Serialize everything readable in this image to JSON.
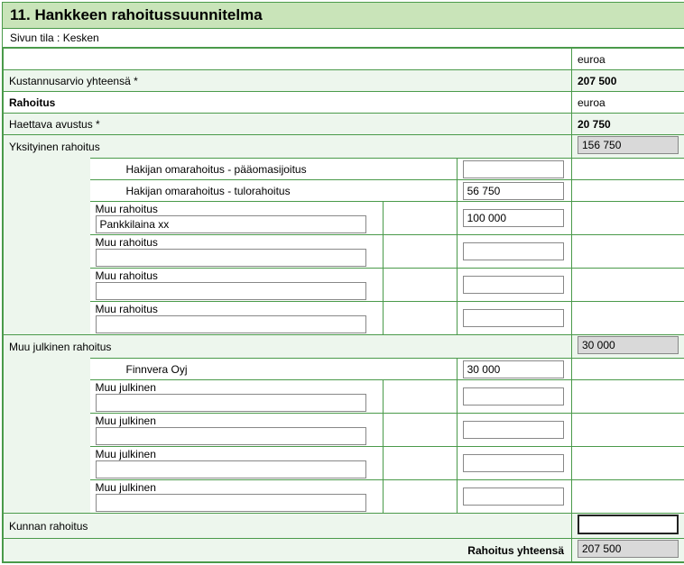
{
  "section": {
    "number": "11.",
    "title": "Hankkeen rahoitussuunnitelma"
  },
  "status": "Sivun tila : Kesken",
  "currency": "euroa",
  "rows": {
    "cost_label": "Kustannusarvio yhteensä *",
    "cost_value": "207 500",
    "financing_label": "Rahoitus",
    "financing_unit": "euroa",
    "grant_label": "Haettava avustus *",
    "grant_value": "20 750",
    "private_label": "Yksityinen rahoitus",
    "private_total": "156 750",
    "equity_label": "Hakijan omarahoitus - pääomasijoitus",
    "equity_value": "",
    "income_label": "Hakijan omarahoitus - tulorahoitus",
    "income_value": "56 750",
    "other_label": "Muu rahoitus",
    "other1_desc": "Pankkilaina xx",
    "other1_val": "100 000",
    "other2_desc": "",
    "other2_val": "",
    "other3_desc": "",
    "other3_val": "",
    "other4_desc": "",
    "other4_val": "",
    "public_label": "Muu julkinen rahoitus",
    "public_total": "30 000",
    "finnvera_label": "Finnvera Oyj",
    "finnvera_val": "30 000",
    "pub_label": "Muu julkinen",
    "pub1_desc": "",
    "pub1_val": "",
    "pub2_desc": "",
    "pub2_val": "",
    "pub3_desc": "",
    "pub3_val": "",
    "pub4_desc": "",
    "pub4_val": "",
    "muni_label": "Kunnan rahoitus",
    "muni_val": "",
    "total_label": "Rahoitus yhteensä",
    "total_val": "207 500"
  }
}
